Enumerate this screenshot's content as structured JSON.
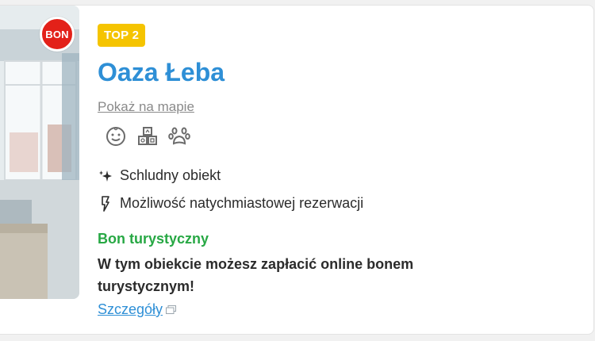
{
  "card": {
    "photo_badge": "BON",
    "rank_badge": "TOP 2",
    "hotel_name": "Oaza Łeba",
    "map_link": "Pokaż na mapie",
    "amenity_icons": [
      "child-friendly-icon",
      "kids-blocks-icon",
      "pets-allowed-icon"
    ],
    "features": [
      {
        "icon": "sparkle-icon",
        "label": "Schludny obiekt"
      },
      {
        "icon": "lightning-icon",
        "label": "Możliwość natychmiastowej rezerwacji"
      }
    ],
    "bon": {
      "title": "Bon turystyczny",
      "description": "W tym obiekcie możesz zapłacić online bonem turystycznym!",
      "details_link": "Szczegóły"
    }
  },
  "colors": {
    "accent_blue": "#2e8fd6",
    "badge_yellow": "#f5c400",
    "bon_red": "#e32119",
    "bon_green": "#27a844"
  }
}
